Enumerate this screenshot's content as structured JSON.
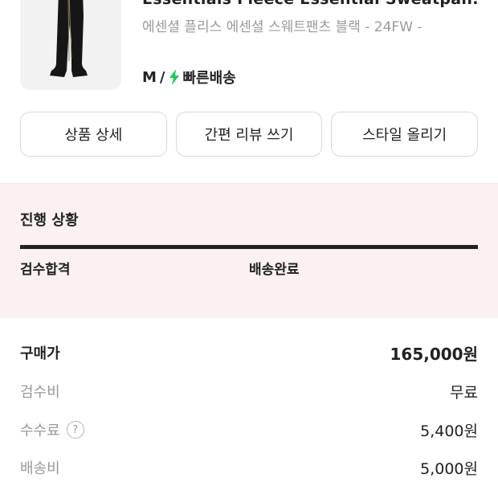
{
  "product": {
    "name": "Essentials Fleece Essential Sweatpan...",
    "subtitle": "에센셜 플리스 에센셜 스웨트팬츠 블랙 - 24FW -",
    "size": "M",
    "separator": "/",
    "delivery": "빠른배송",
    "image_icon": "sweatpants-image"
  },
  "buttons": [
    "상품 상세",
    "간편 리뷰 쓰기",
    "스타일 올리기"
  ],
  "progress": {
    "title": "진행 상황",
    "steps": [
      "검수합격",
      "배송완료"
    ]
  },
  "price": {
    "rows": [
      {
        "label": "구매가",
        "value": "165,000원"
      },
      {
        "label": "검수비",
        "value": "무료"
      },
      {
        "label": "수수료",
        "value": "5,400원",
        "help": "?"
      },
      {
        "label": "배송비",
        "value": "5,000원"
      }
    ]
  },
  "colors": {
    "accent_green": "#22c55e",
    "progress_bg": "#fbf1f1",
    "text_muted": "#999999"
  }
}
